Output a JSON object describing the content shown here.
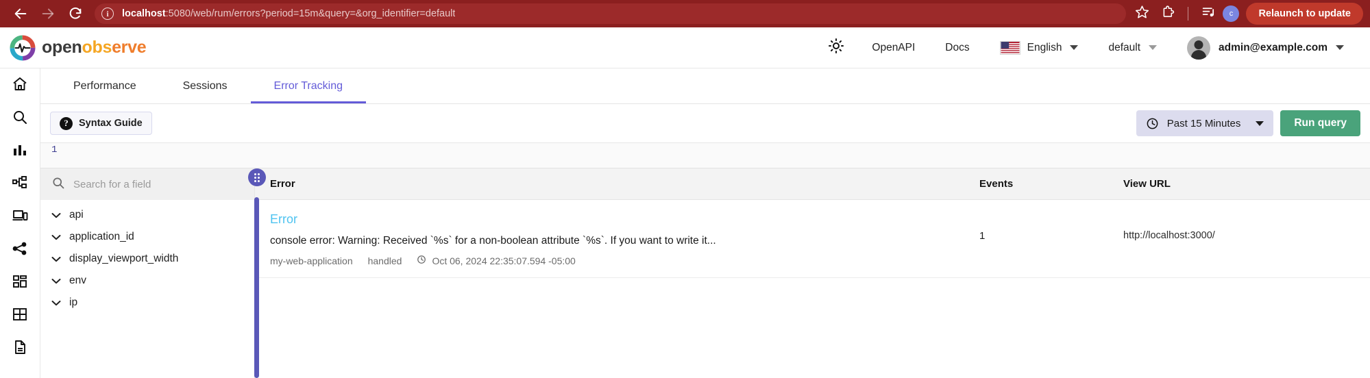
{
  "browser": {
    "back_icon": "back-arrow-icon",
    "forward_icon": "forward-arrow-icon",
    "reload_icon": "reload-icon",
    "site_info_icon": "info-circle-icon",
    "url_host": "localhost",
    "url_rest": ":5080/web/rum/errors?period=15m&query=&org_identifier=default",
    "bookmark_icon": "star-icon",
    "extensions_icon": "extensions-puzzle-icon",
    "media_icon": "media-list-icon",
    "profile_initial": "c",
    "relaunch_label": "Relaunch to update",
    "accent": "#8b1f1f"
  },
  "header": {
    "logo_open": "open",
    "logo_obs": "obs",
    "logo_erve": "erve",
    "theme_icon": "sun-icon",
    "openapi_label": "OpenAPI",
    "docs_label": "Docs",
    "flag_icon": "us-flag-icon",
    "language_label": "English",
    "org_label": "default",
    "avatar_icon": "user-avatar-icon",
    "user_email": "admin@example.com"
  },
  "left_nav": {
    "items": [
      {
        "name": "home-icon",
        "label": "Home"
      },
      {
        "name": "search-icon",
        "label": "Logs"
      },
      {
        "name": "bar-chart-icon",
        "label": "Metrics"
      },
      {
        "name": "pipeline-icon",
        "label": "Traces"
      },
      {
        "name": "devices-icon",
        "label": "RUM"
      },
      {
        "name": "share-nodes-icon",
        "label": "Pipelines"
      },
      {
        "name": "dashboard-grid-icon",
        "label": "Dashboards"
      },
      {
        "name": "table-grid-icon",
        "label": "Streams"
      },
      {
        "name": "document-icon",
        "label": "Reports"
      }
    ]
  },
  "tabs": [
    {
      "label": "Performance",
      "active": false
    },
    {
      "label": "Sessions",
      "active": false
    },
    {
      "label": "Error Tracking",
      "active": true
    }
  ],
  "query_bar": {
    "syntax_guide_label": "Syntax Guide",
    "help_icon": "question-mark-icon",
    "clock_icon": "clock-icon",
    "time_range_label": "Past 15 Minutes",
    "run_query_label": "Run query",
    "editor_line_number": "1",
    "accent_green": "#4aa37b",
    "accent_purple": "#635bd8"
  },
  "field_panel": {
    "search_icon": "search-icon",
    "search_placeholder": "Search for a field",
    "search_value": "",
    "drag_handle_icon": "drag-handle-icon",
    "fields": [
      {
        "label": "api"
      },
      {
        "label": "application_id"
      },
      {
        "label": "display_viewport_width"
      },
      {
        "label": "env"
      },
      {
        "label": "ip"
      }
    ]
  },
  "table": {
    "columns": {
      "error": "Error",
      "events": "Events",
      "view_url": "View URL"
    },
    "rows": [
      {
        "title": "Error",
        "message": "console error: Warning: Received `%s` for a non-boolean attribute `%s`. If you want to write it...",
        "service": "my-web-application",
        "handled": "handled",
        "timestamp_icon": "clock-icon",
        "timestamp": "Oct 06, 2024 22:35:07.594 -05:00",
        "events": "1",
        "url": "http://localhost:3000/"
      }
    ]
  }
}
